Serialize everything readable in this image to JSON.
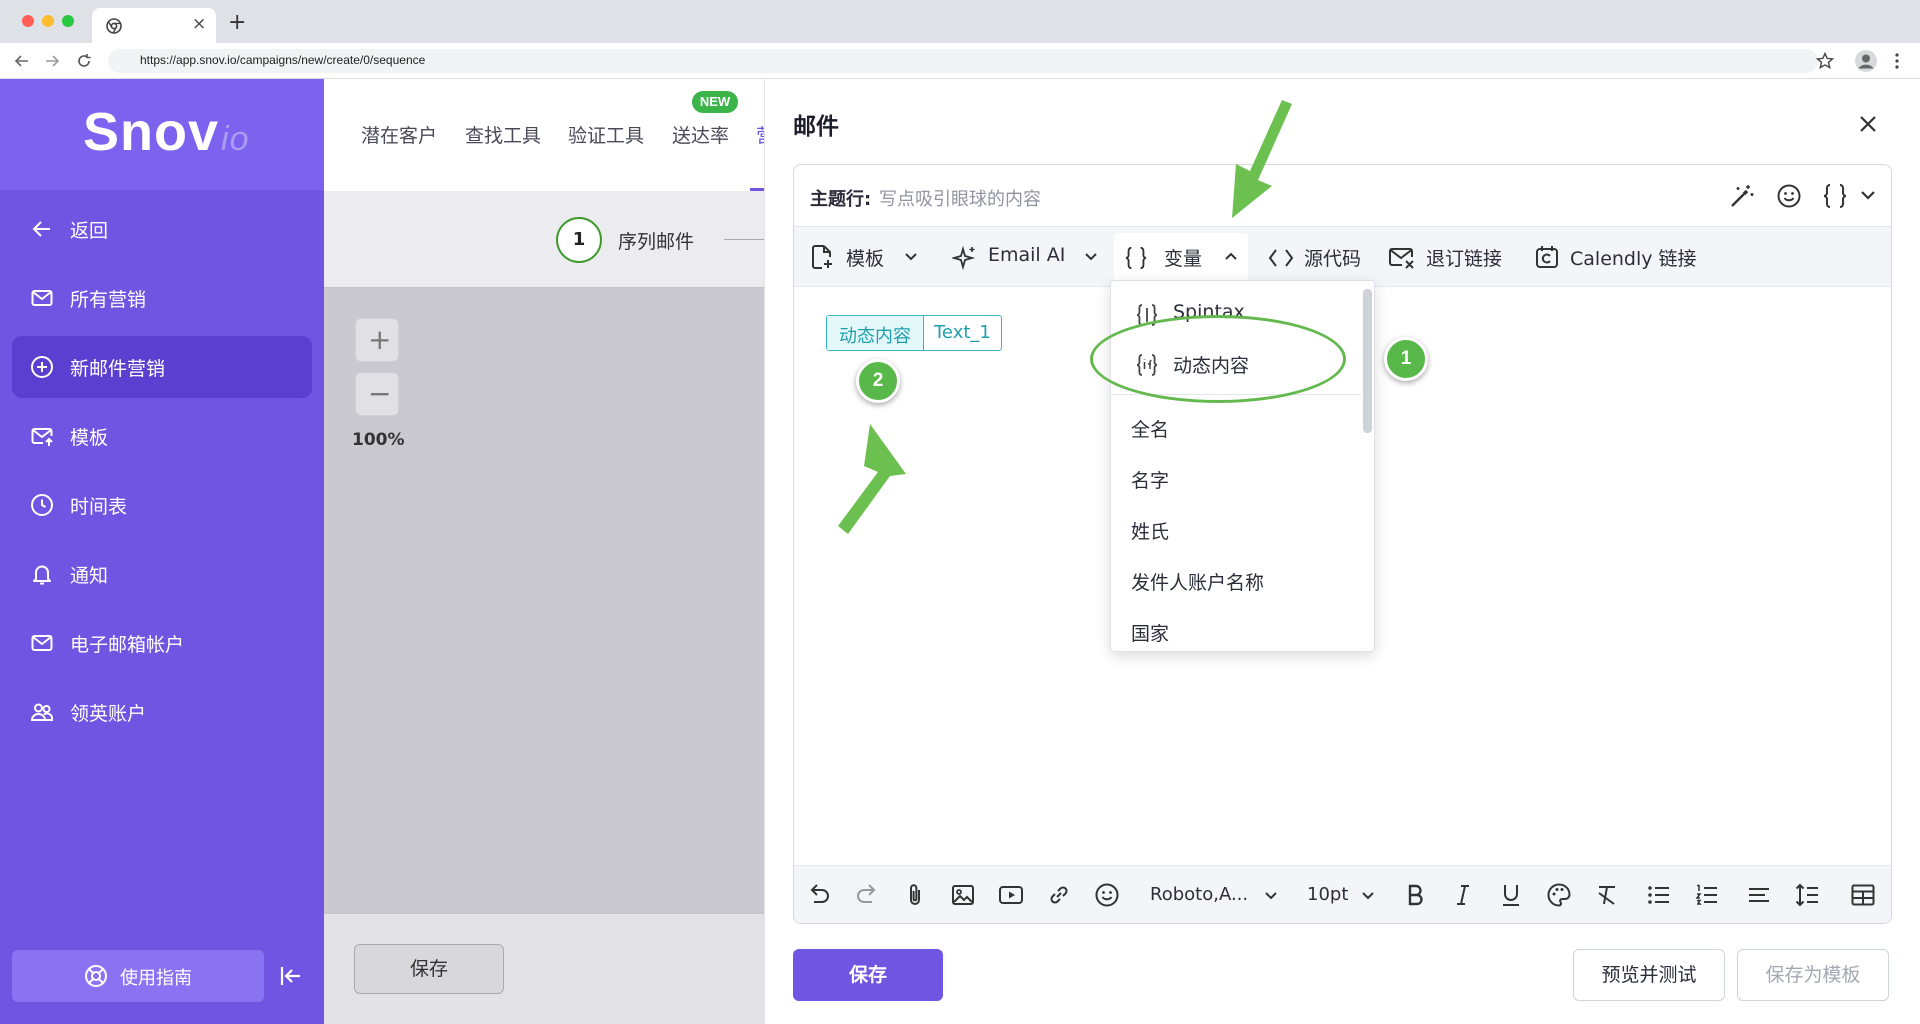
{
  "browser": {
    "url": "https://app.snov.io/campaigns/new/create/0/sequence",
    "new_tab_glyph": "+",
    "tab_close_glyph": "×"
  },
  "sidebar": {
    "logo_main": "Snov",
    "logo_suffix": "io",
    "items": [
      {
        "label": "返回",
        "icon": "arrow-left-icon"
      },
      {
        "label": "所有营销",
        "icon": "mail-icon"
      },
      {
        "label": "新邮件营销",
        "icon": "plus-circle-icon",
        "active": true
      },
      {
        "label": "模板",
        "icon": "mail-template-icon"
      },
      {
        "label": "时间表",
        "icon": "clock-icon"
      },
      {
        "label": "通知",
        "icon": "bell-icon"
      },
      {
        "label": "电子邮箱帐户",
        "icon": "mail-icon"
      },
      {
        "label": "领英账户",
        "icon": "users-icon"
      }
    ],
    "guide_label": "使用指南"
  },
  "topnav": {
    "items": [
      "潜在客户",
      "查找工具",
      "验证工具",
      "送达率"
    ],
    "cut_item": "营",
    "new_badge": "NEW"
  },
  "sequence": {
    "step_number": "1",
    "step_label": "序列邮件",
    "zoom_in": "+",
    "zoom_out": "−",
    "zoom_level": "100%",
    "save_label": "保存"
  },
  "panel": {
    "title": "邮件",
    "subject_label": "主题行:",
    "subject_placeholder": "写点吸引眼球的内容",
    "toolbar": {
      "template": "模板",
      "email_ai": "Email AI",
      "variables": "变量",
      "source": "源代码",
      "unsubscribe": "退订链接",
      "calendly": "Calendly 链接"
    },
    "chip": {
      "name": "动态内容",
      "value": "Text_1"
    },
    "bottom_toolbar": {
      "font": "Roboto,A...",
      "size": "10pt"
    },
    "buttons": {
      "save": "保存",
      "preview": "预览并测试",
      "save_template": "保存为模板"
    }
  },
  "dropdown": {
    "items": [
      "Spintax",
      "动态内容",
      "全名",
      "名字",
      "姓氏",
      "发件人账户名称",
      "国家"
    ]
  },
  "annotations": {
    "badge1": "1",
    "badge2": "2"
  },
  "colors": {
    "primary": "#6f55e2",
    "accent_green": "#59b84a",
    "chip_teal": "#1e9fae"
  }
}
